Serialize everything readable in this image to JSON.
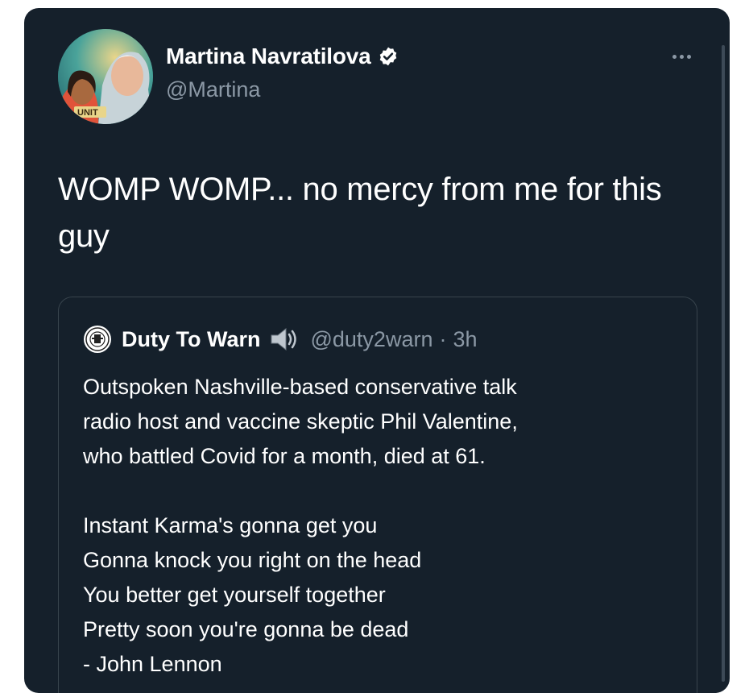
{
  "tweet": {
    "author": {
      "name": "Martina Navratilova",
      "handle": "@Martina",
      "verified": true,
      "avatar_badge_text": "UNIT"
    },
    "text": "WOMP WOMP... no mercy from me for this guy",
    "more_icon": "more-horizontal-icon"
  },
  "quoted_tweet": {
    "author": {
      "name": "Duty To Warn",
      "emoji": "speaker-icon",
      "handle": "@duty2warn",
      "separator": "·",
      "time": "3h"
    },
    "lines": [
      "Outspoken Nashville-based conservative talk",
      "radio host and vaccine skeptic Phil Valentine,",
      "who battled Covid for a month, died at 61.",
      "",
      "Instant Karma's gonna get you",
      "Gonna knock you right on the head",
      "You better get yourself together",
      "Pretty soon you're gonna be dead",
      "- John Lennon"
    ]
  },
  "colors": {
    "background": "#15202b",
    "text": "#ffffff",
    "secondary_text": "#8b98a5",
    "border": "#38444d"
  }
}
